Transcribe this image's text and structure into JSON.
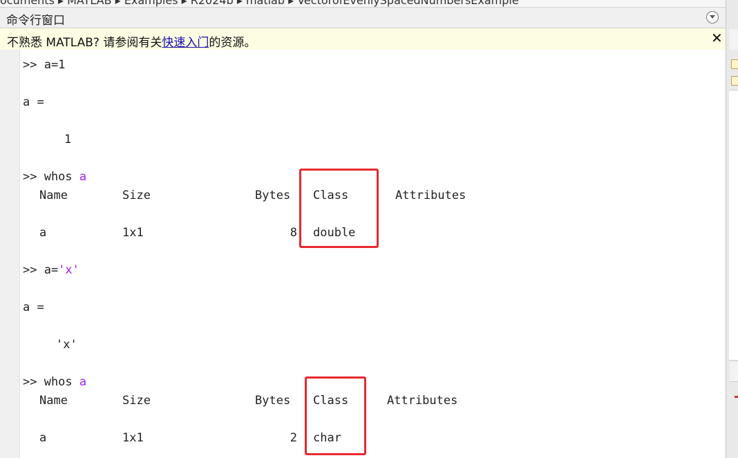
{
  "breadcrumb": {
    "path": "ocuments ▸ MATLAB ▸ Examples ▸ R2024b ▸ matlab ▸ VectorofEvenlySpacedNumbersExample"
  },
  "panel": {
    "title": "命令行窗口",
    "menu_icon": "chevron-down-circle-icon"
  },
  "notice": {
    "prefix": "不熟悉 MATLAB? 请参阅有关",
    "link": "快速入门",
    "suffix": "的资源。",
    "close_label": "✕"
  },
  "console": {
    "block1": {
      "prompt": ">> a=1",
      "var": "a =",
      "value": "1"
    },
    "block2": {
      "prompt": ">> whos",
      "arg": "a",
      "header": {
        "name": "Name",
        "size": "Size",
        "bytes": "Bytes",
        "class": "Class",
        "attributes": "Attributes"
      },
      "row": {
        "name": "a",
        "size": "1x1",
        "bytes": "8",
        "class": "double"
      }
    },
    "block3": {
      "prompt": ">> a=",
      "str": "'x'",
      "var": "a =",
      "value": "'x'"
    },
    "block4": {
      "prompt": ">> whos",
      "arg": "a",
      "header": {
        "name": "Name",
        "size": "Size",
        "bytes": "Bytes",
        "class": "Class",
        "attributes": "Attributes"
      },
      "row": {
        "name": "a",
        "size": "1x1",
        "bytes": "2",
        "class": "char"
      }
    }
  },
  "colors": {
    "highlight": "#e8282f",
    "argument": "#a020f0",
    "notice_bg": "#fdfde4",
    "link": "#1a0dab"
  }
}
